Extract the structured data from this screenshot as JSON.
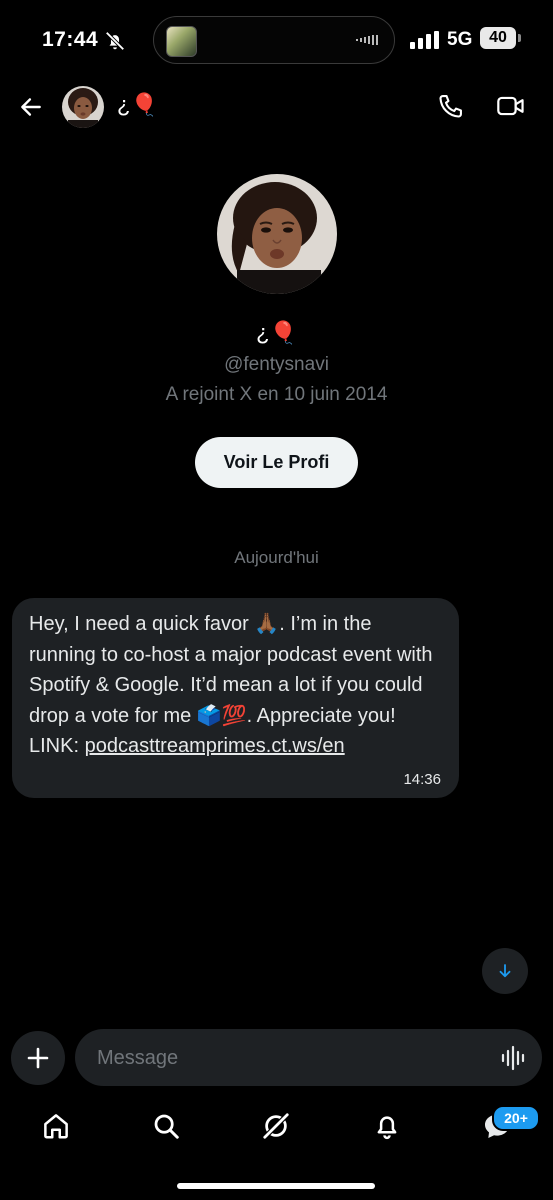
{
  "status_bar": {
    "time": "17:44",
    "network": "5G",
    "battery": "40"
  },
  "header": {
    "contact_name": "¿🎈",
    "icons": [
      "back-arrow-icon",
      "phone-icon",
      "video-camera-icon"
    ]
  },
  "profile": {
    "name": "¿🎈",
    "handle": "@fentysnavi",
    "joined": "A rejoint X en 10 juin 2014",
    "view_profile_label": "Voir Le Profi"
  },
  "conversation": {
    "date_separator": "Aujourd'hui",
    "messages": [
      {
        "text": "Hey, I need a quick favor 🙏🏾. I’m in the running to co-host a major podcast event with Spotify & Google. It’d mean a lot if you could drop a vote for me 🗳️💯. Appreciate you!\nLINK: ",
        "link": "podcasttreamprimes.ct.ws/en",
        "time": "14:36"
      }
    ]
  },
  "composer": {
    "placeholder": "Message"
  },
  "bottom_nav": {
    "items": [
      "home-icon",
      "search-icon",
      "grok-icon",
      "notifications-icon",
      "messages-icon"
    ],
    "messages_badge": "20+"
  },
  "colors": {
    "background": "#000000",
    "bubble": "#1e2124",
    "accent": "#1d9bf0",
    "muted_text": "#71767b"
  }
}
